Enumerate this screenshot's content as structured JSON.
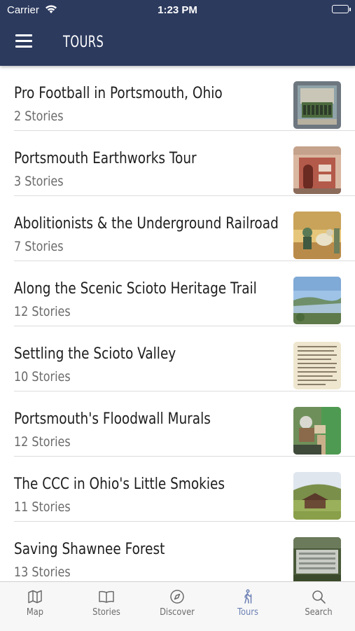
{
  "status_bar": {
    "carrier": "Carrier",
    "time": "1:23 PM"
  },
  "header": {
    "title": "TOURS",
    "menu_icon": "hamburger-menu-icon"
  },
  "tours": [
    {
      "name": "Pro Football in Portsmouth, Ohio",
      "count": "2 Stories"
    },
    {
      "name": "Portsmouth Earthworks Tour",
      "count": "3 Stories"
    },
    {
      "name": "Abolitionists & the Underground Railroad",
      "count": "7 Stories"
    },
    {
      "name": "Along the Scenic Scioto Heritage Trail",
      "count": "12 Stories"
    },
    {
      "name": "Settling the Scioto Valley",
      "count": "10 Stories"
    },
    {
      "name": "Portsmouth's Floodwall Murals",
      "count": "12 Stories"
    },
    {
      "name": "The CCC in Ohio's Little Smokies",
      "count": "11 Stories"
    },
    {
      "name": "Saving Shawnee Forest",
      "count": "13 Stories"
    }
  ],
  "tabs": [
    {
      "label": "Map",
      "icon": "map-icon"
    },
    {
      "label": "Stories",
      "icon": "book-icon"
    },
    {
      "label": "Discover",
      "icon": "compass-icon"
    },
    {
      "label": "Tours",
      "icon": "walking-person-icon",
      "active": true
    },
    {
      "label": "Search",
      "icon": "search-icon"
    }
  ],
  "colors": {
    "header_bg": "#2c3a5e",
    "active_tab": "#6b7fb3",
    "inactive_tab": "#6b6b6b"
  }
}
